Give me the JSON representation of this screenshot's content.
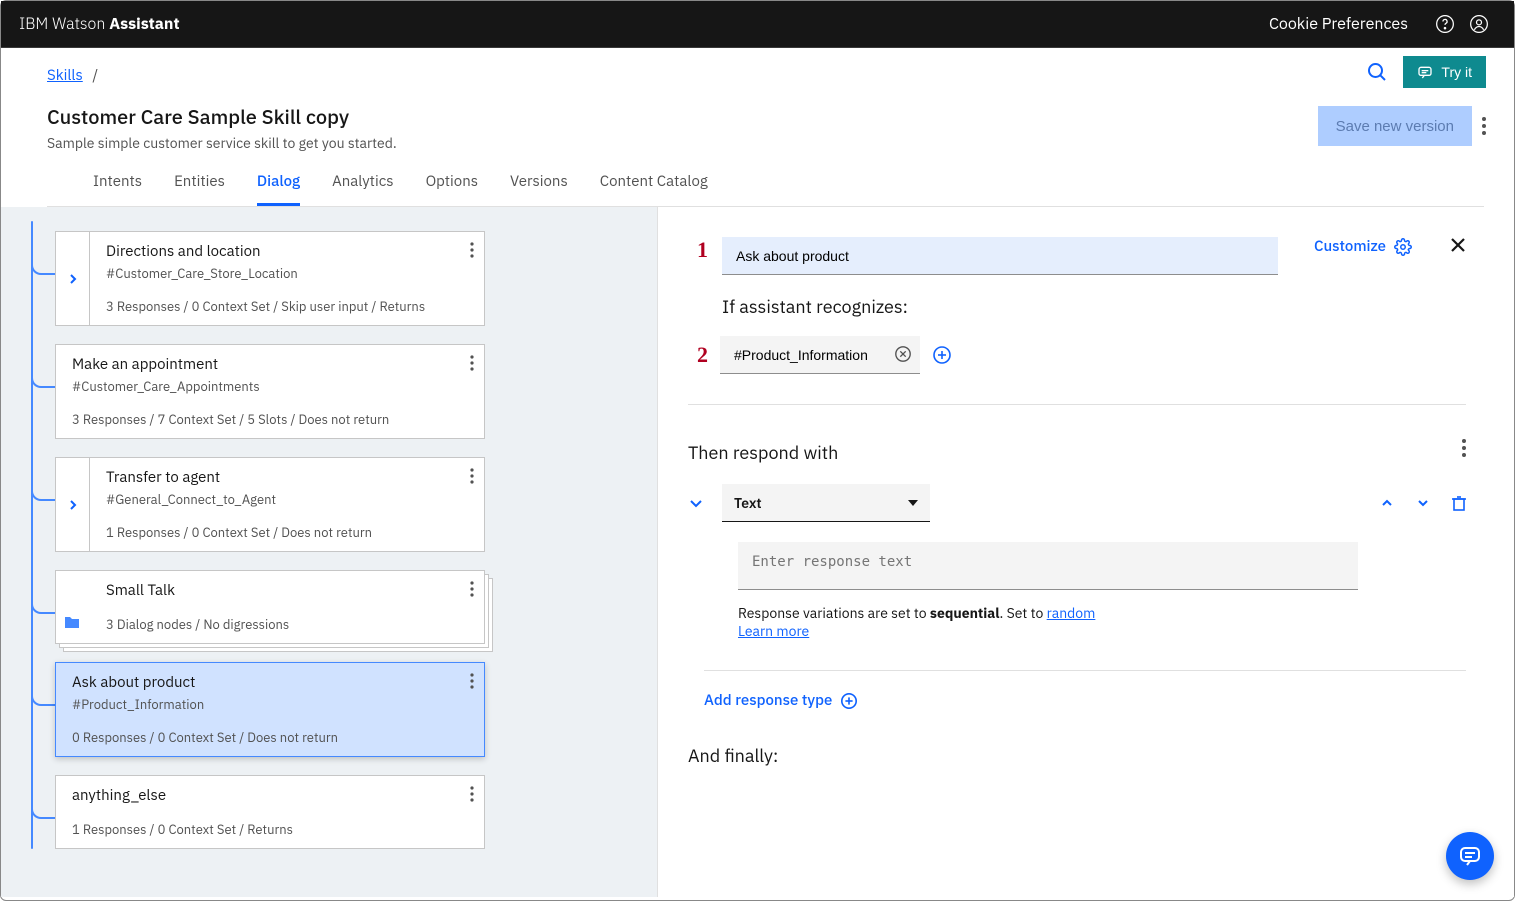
{
  "topbar": {
    "brand_light": "IBM Watson ",
    "brand_bold": "Assistant",
    "cookie_prefs": "Cookie Preferences"
  },
  "header": {
    "breadcrumb_skills": "Skills",
    "breadcrumb_sep": "/",
    "title": "Customer Care Sample Skill copy",
    "subtitle": "Sample simple customer service skill to get you started.",
    "try_it": "Try it",
    "save_version": "Save new version"
  },
  "tabs": {
    "intents": "Intents",
    "entities": "Entities",
    "dialog": "Dialog",
    "analytics": "Analytics",
    "options": "Options",
    "versions": "Versions",
    "catalog": "Content Catalog"
  },
  "tree": [
    {
      "id": "directions",
      "title": "Directions and location",
      "intent": "#Customer_Care_Store_Location",
      "meta": "3 Responses / 0 Context Set / Skip user input / Returns",
      "expandable": true,
      "folder": false,
      "selected": false,
      "stack": false
    },
    {
      "id": "appointment",
      "title": "Make an appointment",
      "intent": "#Customer_Care_Appointments",
      "meta": "3 Responses / 7 Context Set / 5 Slots / Does not return",
      "expandable": false,
      "folder": false,
      "selected": false,
      "stack": false
    },
    {
      "id": "transfer",
      "title": "Transfer to agent",
      "intent": "#General_Connect_to_Agent",
      "meta": "1 Responses / 0 Context Set / Does not return",
      "expandable": true,
      "folder": false,
      "selected": false,
      "stack": false
    },
    {
      "id": "smalltalk",
      "title": "Small Talk",
      "intent": "",
      "meta": "3 Dialog nodes / No digressions",
      "expandable": false,
      "folder": true,
      "selected": false,
      "stack": true
    },
    {
      "id": "askproduct",
      "title": "Ask about product",
      "intent": "#Product_Information",
      "meta": "0 Responses / 0 Context Set / Does not return",
      "expandable": false,
      "folder": false,
      "selected": true,
      "stack": false
    },
    {
      "id": "anythingelse",
      "title": "anything_else",
      "intent": "",
      "meta": "1 Responses / 0 Context Set / Returns",
      "expandable": false,
      "folder": false,
      "selected": false,
      "stack": false
    }
  ],
  "editor": {
    "callout1": "1",
    "callout2": "2",
    "node_name": "Ask about product",
    "customize": "Customize",
    "recognizes_label": "If assistant recognizes:",
    "condition": "#Product_Information",
    "respond_label": "Then respond with",
    "type_selected": "Text",
    "response_placeholder": "Enter response text",
    "variation_prefix": "Response variations are set to ",
    "variation_mode": "sequential",
    "variation_mid": ". Set to ",
    "variation_link": "random",
    "learn_more": "Learn more",
    "add_response_type": "Add response type",
    "finally": "And finally:"
  }
}
